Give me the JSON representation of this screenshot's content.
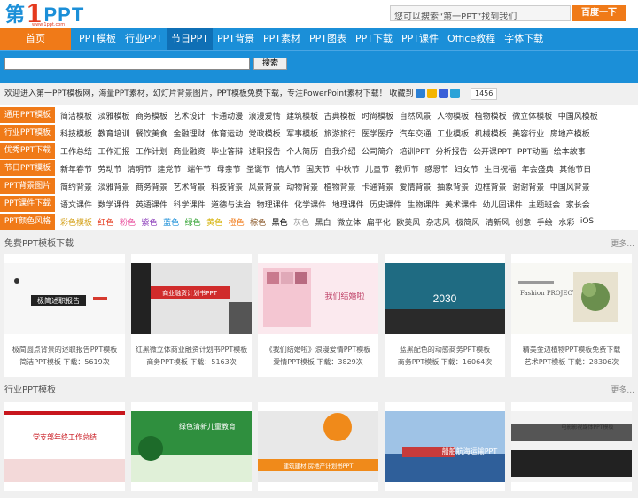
{
  "header": {
    "logo_char": "第",
    "logo_num": "1",
    "logo_ppt": "PPT",
    "logo_sub": "www.1ppt.com",
    "search_placeholder": "您可以搜索“第一PPT”找到我们",
    "search_button": "百度一下"
  },
  "nav": {
    "home": "首页",
    "items": [
      "PPT模板",
      "行业PPT",
      "节日PPT",
      "PPT背景",
      "PPT素材",
      "PPT图表",
      "PPT下载",
      "PPT课件",
      "Office教程",
      "字体下载"
    ],
    "active_index": 2
  },
  "searchbar": {
    "button": "搜索"
  },
  "welcome": {
    "text": "欢迎进入第一PPT模板网，海量PPT素材，幻灯片背景图片，PPT模板免费下载，专注PowerPoint素材下载！ 收藏到",
    "count": "1456"
  },
  "categories": [
    {
      "label": "通用PPT模板",
      "links": [
        "简洁模板",
        "淡雅模板",
        "商务模板",
        "艺术设计",
        "卡通动漫",
        "浪漫爱情",
        "建筑模板",
        "古典模板",
        "时尚模板",
        "自然风景",
        "人物模板",
        "植物模板",
        "微立体模板",
        "中国风模板"
      ]
    },
    {
      "label": "行业PPT模板",
      "links": [
        "科技模板",
        "教育培训",
        "餐饮美食",
        "金融理财",
        "体育运动",
        "党政模板",
        "军事模板",
        "旅游旅行",
        "医学医疗",
        "汽车交通",
        "工业模板",
        "机械模板",
        "美容行业",
        "房地产模板"
      ]
    },
    {
      "label": "优秀PPT下载",
      "links": [
        "工作总结",
        "工作汇报",
        "工作计划",
        "商业融资",
        "毕业答辩",
        "述职报告",
        "个人简历",
        "自我介绍",
        "公司简介",
        "培训PPT",
        "分析报告",
        "公开课PPT",
        "PPT动画",
        "绘本故事"
      ]
    },
    {
      "label": "节日PPT模板",
      "links": [
        "新年春节",
        "劳动节",
        "清明节",
        "建党节",
        "端午节",
        "母亲节",
        "圣诞节",
        "情人节",
        "国庆节",
        "中秋节",
        "儿童节",
        "教师节",
        "感恩节",
        "妇女节",
        "生日祝福",
        "年会盛典",
        "其他节日"
      ]
    },
    {
      "label": "PPT背景图片",
      "links": [
        "简约背景",
        "淡雅背景",
        "商务背景",
        "艺术背景",
        "科技背景",
        "风景背景",
        "动物背景",
        "植物背景",
        "卡通背景",
        "爱情背景",
        "抽象背景",
        "边框背景",
        "谢谢背景",
        "中国风背景"
      ]
    },
    {
      "label": "PPT课件下载",
      "links": [
        "语文课件",
        "数学课件",
        "英语课件",
        "科学课件",
        "道德与法治",
        "物理课件",
        "化学课件",
        "地理课件",
        "历史课件",
        "生物课件",
        "美术课件",
        "幼儿园课件",
        "主题班会",
        "家长会"
      ]
    },
    {
      "label": "PPT颜色风格",
      "links": [
        "彩色模板",
        "红色",
        "粉色",
        "紫色",
        "蓝色",
        "绿色",
        "黄色",
        "橙色",
        "棕色",
        "黑色",
        "灰色",
        "黑白",
        "微立体",
        "扁平化",
        "欧美风",
        "杂志风",
        "极简风",
        "清新风",
        "创意",
        "手绘",
        "水彩",
        "iOS"
      ]
    }
  ],
  "color_style_colors": [
    "#d4a017",
    "#e53a1e",
    "#e84a9a",
    "#8a3ab9",
    "#1b8fd8",
    "#3aa63a",
    "#d4b000",
    "#f07a18",
    "#8b5a2b",
    "#000000",
    "#999999",
    "#333333",
    "#333333",
    "#333333",
    "#333333",
    "#333333",
    "#333333",
    "#333333",
    "#333333",
    "#333333",
    "#333333",
    "#333333"
  ],
  "free_section": {
    "title": "免费PPT模板下载",
    "more": "更多...",
    "cards": [
      {
        "title": "极简圆点背景的述职报告PPT模板",
        "meta": "简洁PPT模板  下载：5619次",
        "thumb_text": "极简述职报告"
      },
      {
        "title": "红黑微立体商业融资计划书PPT模板",
        "meta": "商务PPT模板  下载：5163次",
        "thumb_text": "商业融资计划书PPT"
      },
      {
        "title": "《我们结婚啦》浪漫爱情PPT模板",
        "meta": "爱情PPT模板  下载：3829次",
        "thumb_text": "我们结婚啦"
      },
      {
        "title": "蓝黑配色的动感商务PPT模板",
        "meta": "商务PPT模板  下载：16064次",
        "thumb_text": "2030"
      },
      {
        "title": "精美金边植物PPT模板免费下载",
        "meta": "艺术PPT模板  下载：28306次",
        "thumb_text": "Fashion PROJECT"
      }
    ]
  },
  "industry_section": {
    "title": "行业PPT模板",
    "more": "更多...",
    "cards": [
      {
        "thumb_text": "党支部年终工作总结"
      },
      {
        "thumb_text": "绿色清新儿童教育"
      },
      {
        "thumb_text": "建筑建材 房地产计划书PPT"
      },
      {
        "thumb_text": "船舶航海运输PPT"
      },
      {
        "thumb_text": "电影影视媒体PPT模板"
      }
    ]
  }
}
